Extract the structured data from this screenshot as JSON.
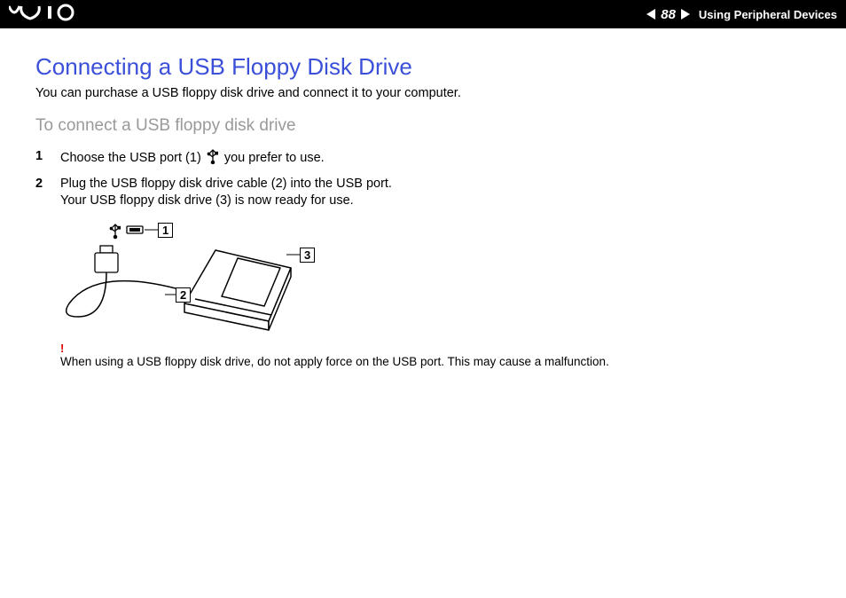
{
  "header": {
    "page_number": "88",
    "section": "Using Peripheral Devices",
    "logo_alt": "VAIO"
  },
  "title": "Connecting a USB Floppy Disk Drive",
  "intro": "You can purchase a USB floppy disk drive and connect it to your computer.",
  "subtitle": "To connect a USB floppy disk drive",
  "steps": [
    {
      "n": "1",
      "before": "Choose the USB port (1) ",
      "after": " you prefer to use."
    },
    {
      "n": "2",
      "line1": "Plug the USB floppy disk drive cable (2) into the USB port.",
      "line2": "Your USB floppy disk drive (3) is now ready for use."
    }
  ],
  "figure": {
    "callouts": [
      "1",
      "2",
      "3"
    ],
    "icons": {
      "usb": "usb-trident-icon",
      "port": "usb-port-icon"
    }
  },
  "caution_mark": "!",
  "caution": "When using a USB floppy disk drive, do not apply force on the USB port. This may cause a malfunction."
}
